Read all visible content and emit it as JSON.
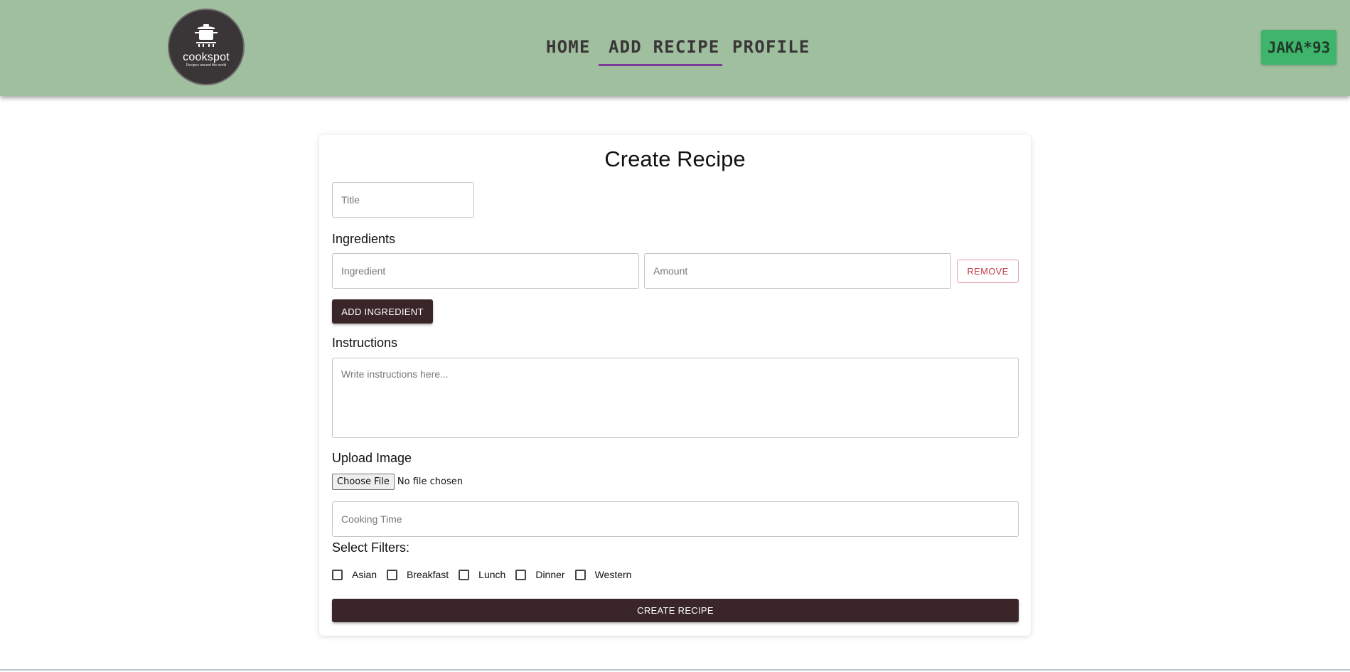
{
  "header": {
    "logo": {
      "name": "cookspot",
      "tagline": "Recipes around the world"
    },
    "nav": {
      "home": "HOME",
      "add_recipe": "ADD RECIPE",
      "profile": "PROFILE",
      "active": "ADD RECIPE"
    },
    "user": "JAKA*93"
  },
  "form": {
    "title": "Create Recipe",
    "title_placeholder": "Title",
    "ingredients_label": "Ingredients",
    "ingredient_placeholder": "Ingredient",
    "amount_placeholder": "Amount",
    "remove_label": "REMOVE",
    "add_ingredient_label": "ADD INGREDIENT",
    "instructions_label": "Instructions",
    "instructions_placeholder": "Write instructions here...",
    "upload_label": "Upload Image",
    "choose_file_label": "Choose File",
    "file_status": "No file chosen",
    "cooking_time_placeholder": "Cooking Time",
    "filters_label": "Select Filters:",
    "filters": [
      {
        "label": "Asian",
        "checked": false
      },
      {
        "label": "Breakfast",
        "checked": false
      },
      {
        "label": "Lunch",
        "checked": false
      },
      {
        "label": "Dinner",
        "checked": false
      },
      {
        "label": "Western",
        "checked": false
      }
    ],
    "create_label": "CREATE RECIPE"
  },
  "colors": {
    "header_bg": "#9fbf9e",
    "nav_text": "#3a3537",
    "nav_active_underline": "#7c3a9a",
    "user_badge_bg": "#3fb56b",
    "primary_button": "#3a2629",
    "remove_button_text": "#c33b48",
    "logo_bg": "#3a3537"
  },
  "icons": {
    "logo": "cooking-pot-icon"
  }
}
